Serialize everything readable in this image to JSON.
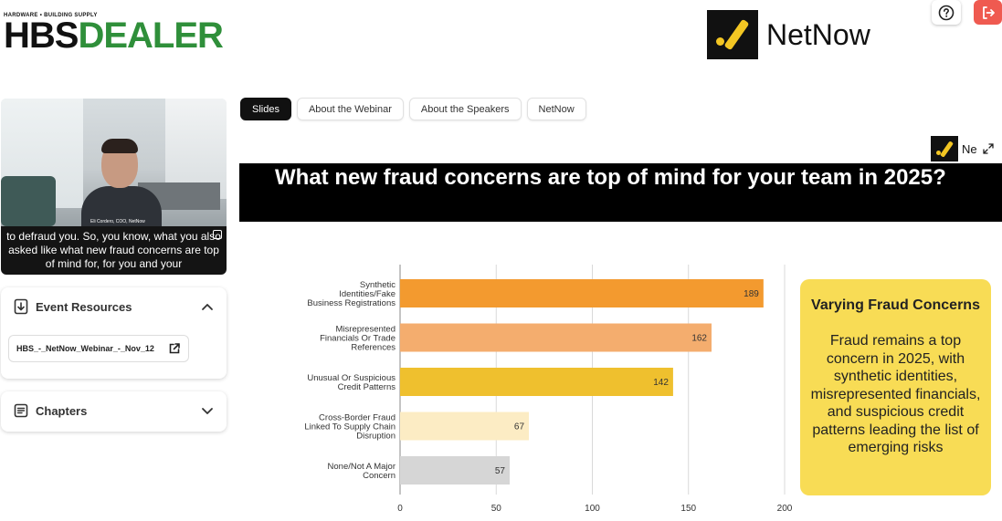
{
  "header": {
    "brand_small": "HARDWARE • BUILDING SUPPLY",
    "brand_hbs": "HBS",
    "brand_dealer": "DEALER",
    "partner_name": "NetNow",
    "help_icon": "question-circle-icon",
    "exit_icon": "logout-icon",
    "exit_color": "#ef5a50"
  },
  "video": {
    "speaker_tag": "Eli Cordero, COO, NetNow",
    "caption": "to defraud you. So, you know, what you also asked like what new fraud concerns are top of mind for, for you and your"
  },
  "resources": {
    "title": "Event Resources",
    "file": "HBS_-_NetNow_Webinar_-_Nov_12"
  },
  "chapters": {
    "title": "Chapters"
  },
  "tabs": [
    {
      "label": "Slides",
      "active": true
    },
    {
      "label": "About the Webinar",
      "active": false
    },
    {
      "label": "About the Speakers",
      "active": false
    },
    {
      "label": "NetNow",
      "active": false
    }
  ],
  "slide": {
    "partial_logo_text": "Ne",
    "title": "What new fraud concerns are top of mind for your team in 2025?",
    "callout_title": "Varying Fraud Concerns",
    "callout_body": "Fraud remains a top concern in 2025, with synthetic identities, misrepresented financials, and suspicious credit patterns leading the list of emerging risks",
    "callout_color": "#f8dc55"
  },
  "chart_data": {
    "type": "bar",
    "orientation": "horizontal",
    "categories": [
      [
        "Synthetic",
        "Identities/Fake",
        "Business Registrations"
      ],
      [
        "Misrepresented",
        "Financials Or Trade",
        "References"
      ],
      [
        "Unusual Or Suspicious",
        "Credit Patterns"
      ],
      [
        "Cross-Border Fraud",
        "Linked To Supply Chain",
        "Disruption"
      ],
      [
        "None/Not A Major",
        "Concern"
      ]
    ],
    "values": [
      189,
      162,
      142,
      67,
      57
    ],
    "colors": [
      "#f39a2f",
      "#f4ad6e",
      "#efc02e",
      "#fcecc4",
      "#d6d6d6"
    ],
    "xlim": [
      0,
      200
    ],
    "xticks": [
      0,
      50,
      100,
      150,
      200
    ],
    "grid": true
  }
}
